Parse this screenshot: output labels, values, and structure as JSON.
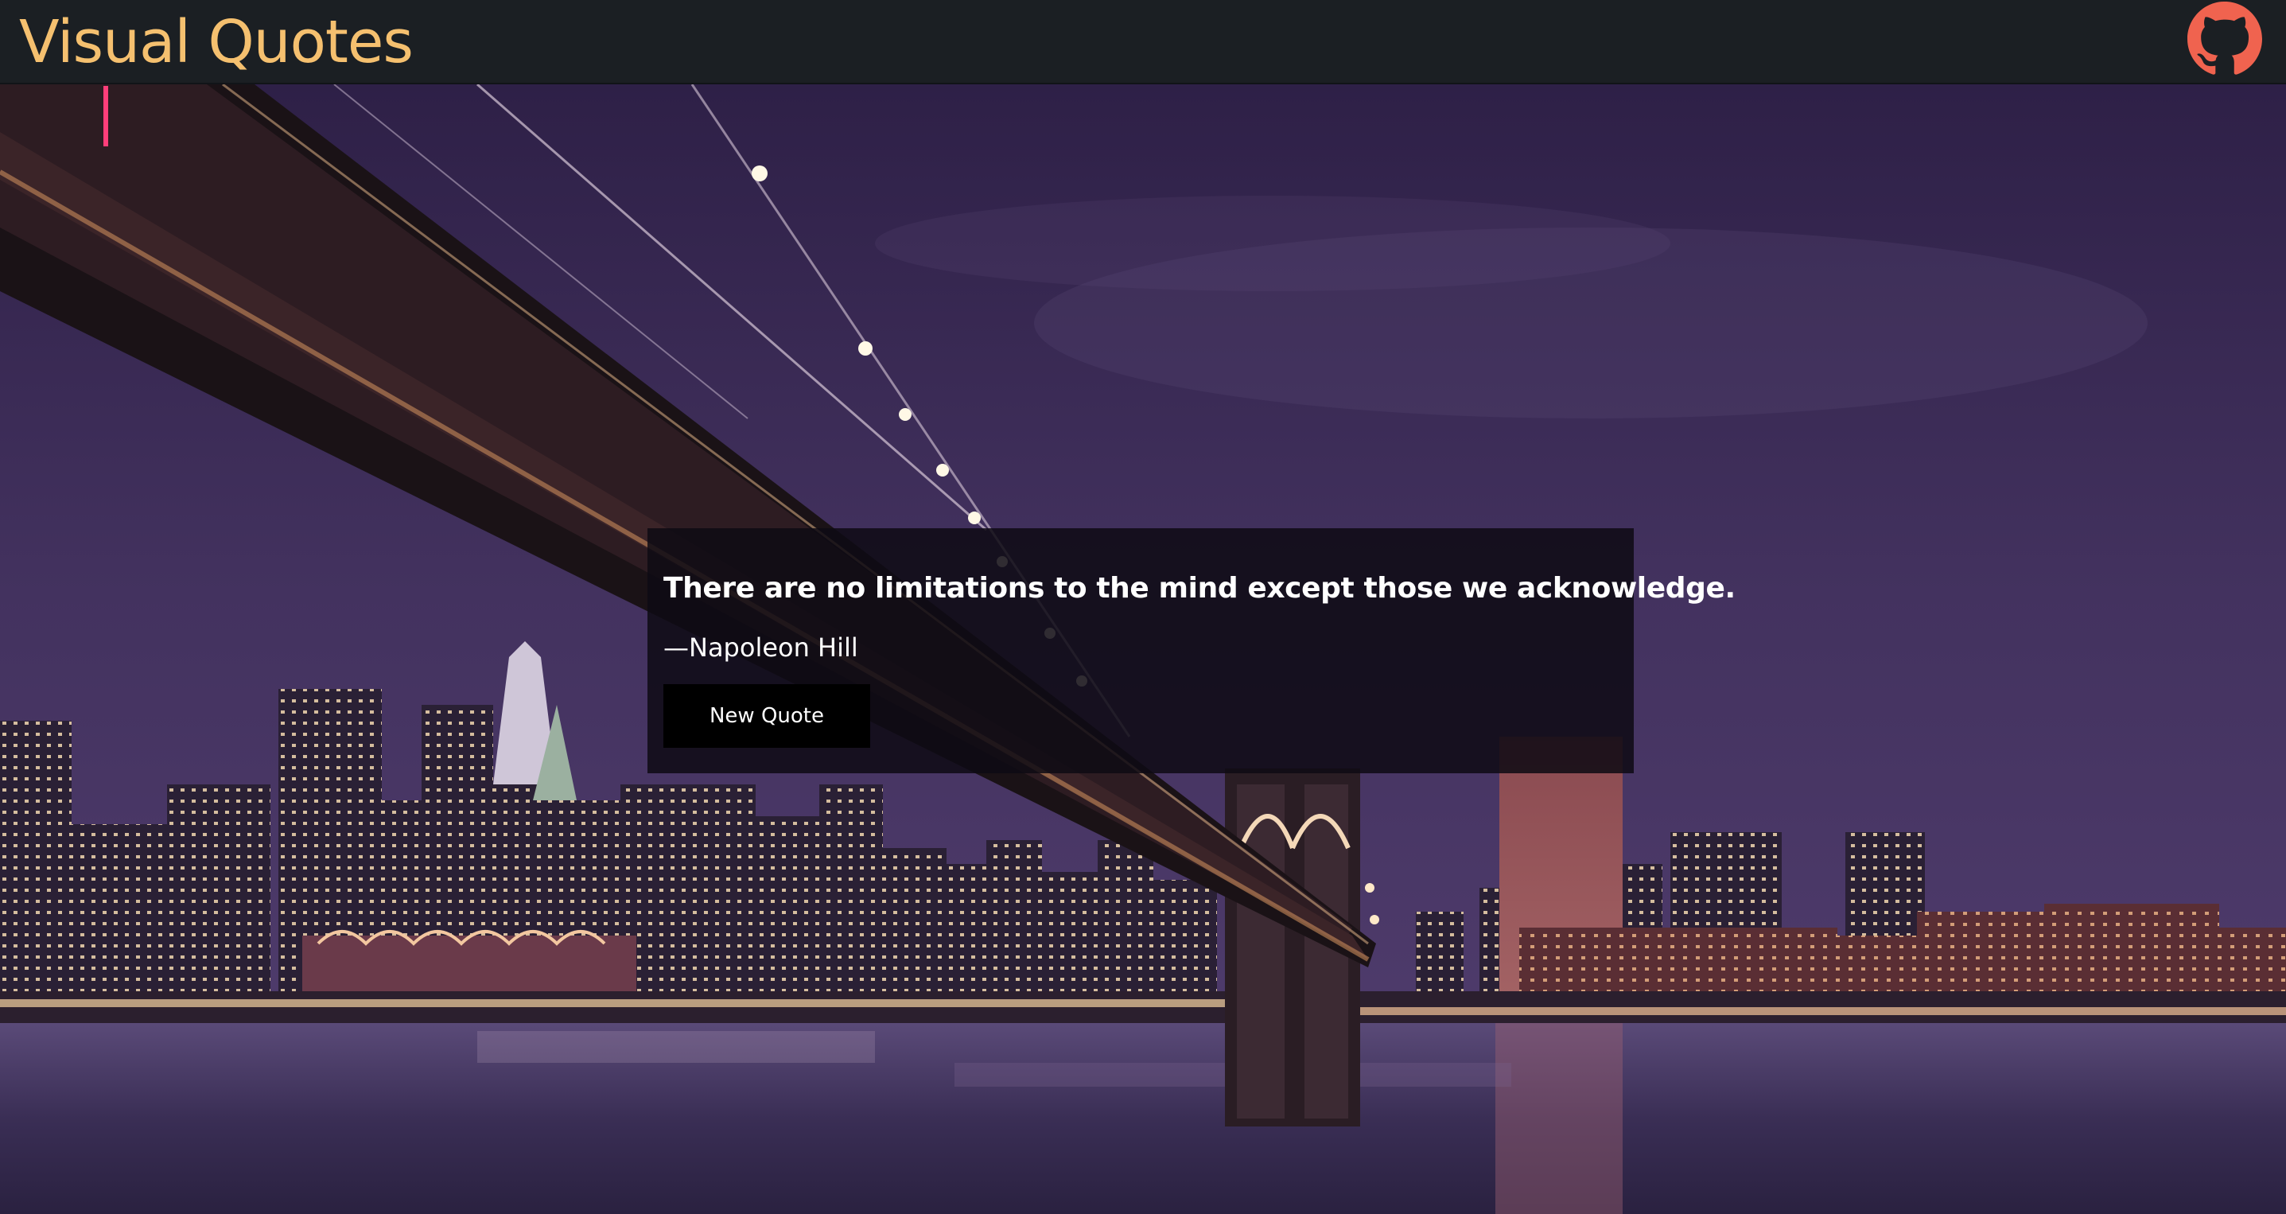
{
  "header": {
    "title": "Visual Quotes",
    "github_icon": "github-icon",
    "title_color": "#f5c06f",
    "icon_color": "#f0634f"
  },
  "background": {
    "description_icon": "city-bridge-night-photo"
  },
  "quote": {
    "text": "There are no limitations to the mind except those we acknowledge.",
    "author": "—Napoleon Hill",
    "button_label": "New Quote"
  }
}
